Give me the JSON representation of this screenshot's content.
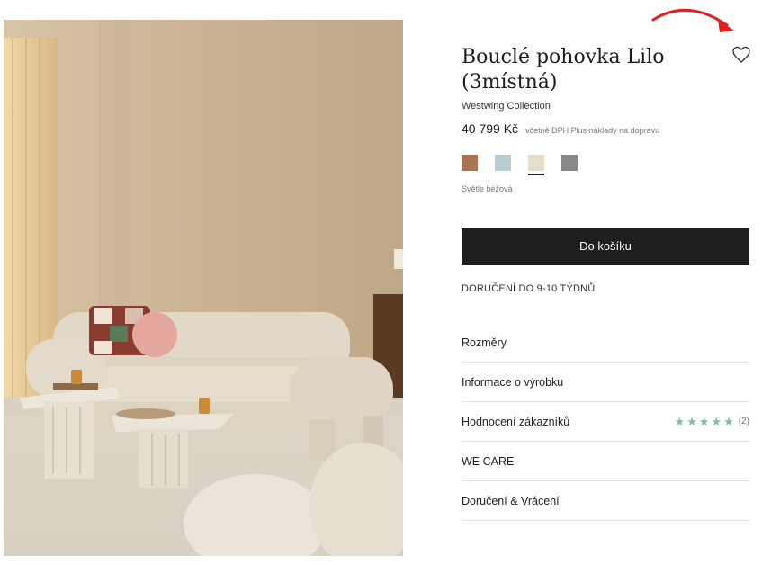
{
  "product": {
    "title_line1": "Bouclé pohovka Lilo",
    "title_line2": "(3místná)",
    "brand": "Westwing Collection",
    "price": "40 799 Kč",
    "price_note": "včetně DPH Plus náklady na dopravu",
    "selected_color_name": "Světle béžová"
  },
  "swatches": [
    {
      "color": "#a87550",
      "selected": false
    },
    {
      "color": "#b9ccd6",
      "selected": false
    },
    {
      "color": "#e6dcca",
      "selected": true
    },
    {
      "color": "#888886",
      "selected": false
    }
  ],
  "actions": {
    "add_to_cart": "Do košíku"
  },
  "delivery_text": "DORUČENÍ DO 9-10 TÝDNŮ",
  "accordion": {
    "dimensions": "Rozměry",
    "product_info": "Informace o výrobku",
    "reviews": "Hodnocení zákazníků",
    "reviews_count": "(2)",
    "reviews_rating": 5,
    "we_care": "WE CARE",
    "shipping": "Doručení & Vrácení"
  },
  "colors": {
    "button_bg": "#1e1e1e",
    "star": "#7fbfa8",
    "annotation_arrow": "#e02020"
  }
}
